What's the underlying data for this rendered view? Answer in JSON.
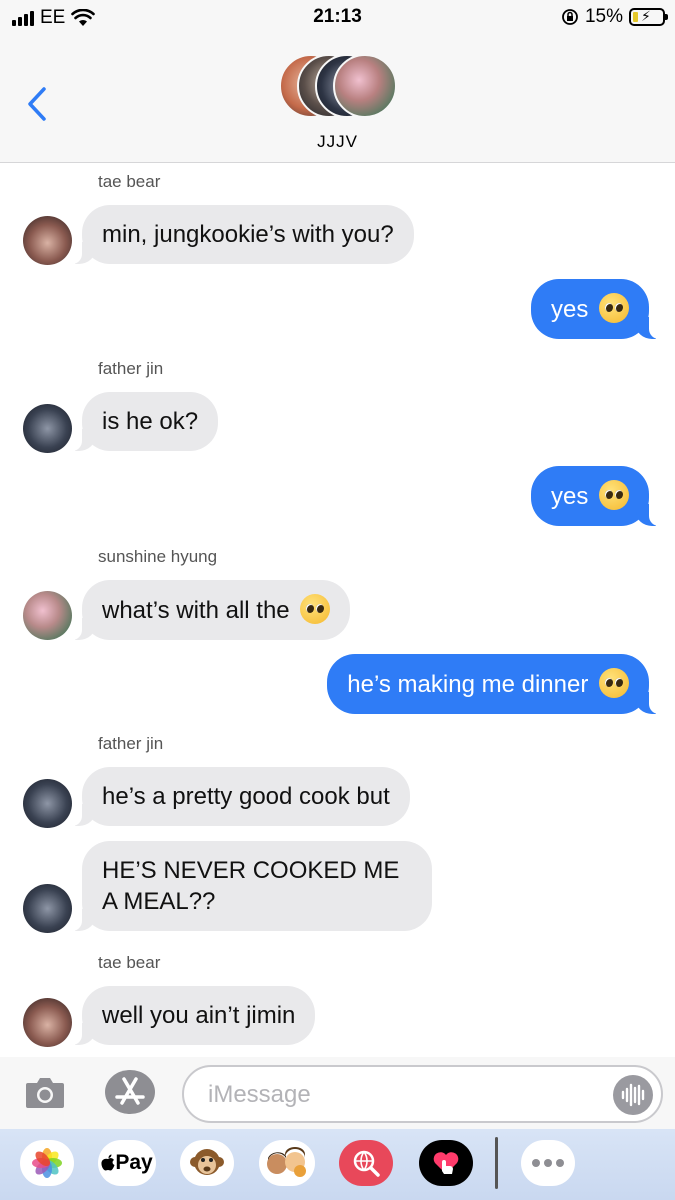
{
  "status_bar": {
    "carrier": "EE",
    "time": "21:13",
    "battery": "15%",
    "battery_level": 0.15
  },
  "header": {
    "group_name": "JJJV"
  },
  "messages": [
    {
      "sender": "tae bear",
      "text": "min, jungkookie’s with you?"
    },
    {
      "text": "yes",
      "emoji": "pleading-face"
    },
    {
      "sender": "father jin",
      "text": "is he ok?"
    },
    {
      "text": "yes",
      "emoji": "pleading-face"
    },
    {
      "sender": "sunshine hyung",
      "text": "what’s with all the",
      "emoji": "pleading-face"
    },
    {
      "text": "he’s making me dinner",
      "emoji": "pleading-face"
    },
    {
      "sender": "father jin",
      "text": "he’s a pretty good cook but"
    },
    {
      "text_line1": "HE’S NEVER COOKED ME",
      "text_line2": "A MEAL??"
    },
    {
      "sender": "tae bear",
      "text": "well you ain’t jimin"
    }
  ],
  "input": {
    "placeholder": "iMessage"
  },
  "app_drawer": {
    "pay_label": "Pay"
  },
  "colors": {
    "outgoing": "#2f7cf6",
    "incoming": "#e9e9eb",
    "accent": "#2f7cf6"
  }
}
